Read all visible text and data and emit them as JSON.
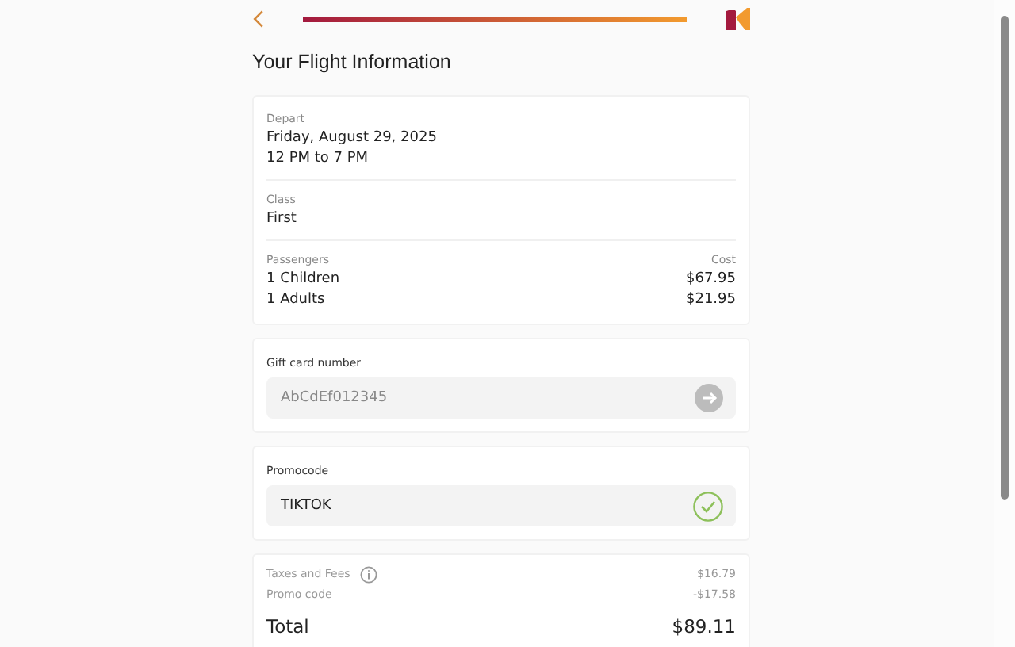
{
  "header": {
    "progress": {
      "level": 1
    }
  },
  "title": "Your Flight Information",
  "summary": {
    "depart_label": "Depart",
    "date": "Friday, August 29, 2025",
    "time": "12 PM to 7 PM",
    "class_label": "Class",
    "class": "First",
    "passengers_label": "Passengers",
    "cost_label": "Cost",
    "passengers": [
      {
        "label": "1 Children",
        "cost": "$67.95"
      },
      {
        "label": "1 Adults",
        "cost": "$21.95"
      }
    ]
  },
  "gift_card": {
    "label": "Gift card number",
    "placeholder": "AbCdEf012345"
  },
  "promocode": {
    "label": "Promocode",
    "value": "TIKTOK",
    "valid": true
  },
  "totals": {
    "fees": [
      {
        "label": "Taxes and Fees",
        "info": true,
        "amount": "$16.79"
      },
      {
        "label": "Promo code",
        "info": false,
        "amount": "-$17.58"
      }
    ],
    "total_label": "Total",
    "total": "$89.11"
  }
}
